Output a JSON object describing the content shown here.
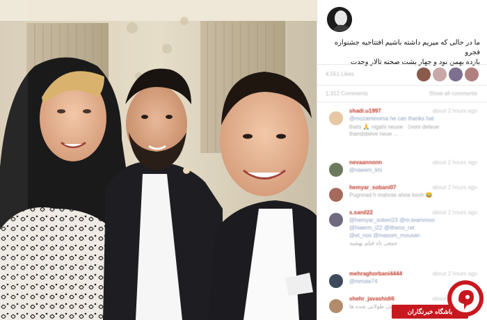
{
  "post": {
    "caption_line1": "ما در حالی که میریم داشته باشیم افتتاحیه جشنواره فجرو",
    "caption_line2": "بازده بهمن نود و چهار پشت صحنه تالار وحدت",
    "likes_text": "4,551 Likes",
    "comments_left": "1,312 Comments",
    "comments_right": "Show all comments"
  },
  "comments": [
    {
      "user": "shadi.u1997",
      "time": "about 2 hours ago",
      "lines": [
        "@mozaminoma he can thanks hat",
        "thats 🙏 nigahi neuve （noni deteue",
        "thandsbeve neue ..."
      ],
      "line_colors": [
        "blue",
        "gray",
        "gray"
      ]
    },
    {
      "user": "nevaannonn",
      "time": "about 2 hours ago",
      "lines": [
        "@naeem_khi"
      ],
      "line_colors": [
        "blue"
      ]
    },
    {
      "user": "hemyar_sobani07",
      "time": "about 2 hours ago",
      "lines": [
        "Pugnnad h mahrae ahne keoh 😂"
      ],
      "line_colors": [
        "gray"
      ]
    },
    {
      "user": "s.sanil22",
      "time": "about 2 hours ago",
      "lines": [
        "@hemyar_soberi23 @m.teammoo",
        "@hiaerm_i22 @ltheno_ret",
        "@et_nos @masom_mousan",
        "جمعی ناه فیلم بهشید"
      ],
      "line_colors": [
        "blue",
        "blue",
        "blue",
        "gray"
      ]
    },
    {
      "user": "mehraghorbani4444",
      "time": "about 2 hours ago",
      "lines": [
        "@mmaw74"
      ],
      "line_colors": [
        "blue"
      ]
    },
    {
      "user": "shehr_javashidi6",
      "time": "about 2 hours ago",
      "lines": [
        "آبی طولانی شده ها"
      ],
      "line_colors": [
        "gray"
      ]
    }
  ],
  "watermark": {
    "text": "باشگاه خبرنگاران"
  },
  "colors": {
    "accent": "#c7181f",
    "mention": "#8aa0c0",
    "username": "#c0392b"
  }
}
